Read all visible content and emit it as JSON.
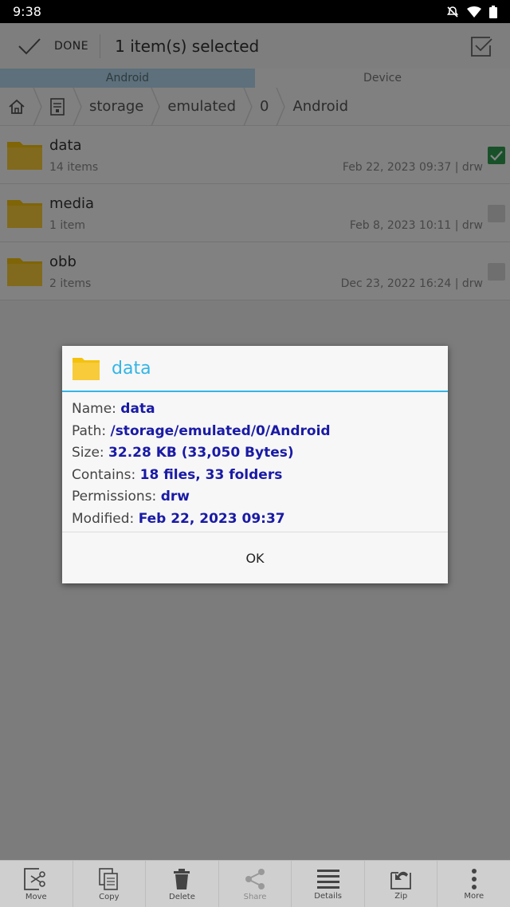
{
  "status_bar": {
    "time": "9:38"
  },
  "action_bar": {
    "done_label": "DONE",
    "title": "1 item(s) selected"
  },
  "tabs": [
    {
      "label": "Android"
    },
    {
      "label": "Device"
    }
  ],
  "breadcrumb": [
    "storage",
    "emulated",
    "0",
    "Android"
  ],
  "files": [
    {
      "name": "data",
      "count": "14 items",
      "modified": "Feb 22, 2023 09:37 | drw",
      "checked": true
    },
    {
      "name": "media",
      "count": "1 item",
      "modified": "Feb 8, 2023 10:11 | drw",
      "checked": false
    },
    {
      "name": "obb",
      "count": "2 items",
      "modified": "Dec 23, 2022 16:24 | drw",
      "checked": false
    }
  ],
  "dialog": {
    "title": "data",
    "rows": [
      {
        "label": "Name:",
        "value": "data"
      },
      {
        "label": "Path:",
        "value": "/storage/emulated/0/Android"
      },
      {
        "label": "Size:",
        "value": "32.28 KB (33,050 Bytes)"
      },
      {
        "label": "Contains:",
        "value": "18 files, 33 folders"
      },
      {
        "label": "Permissions:",
        "value": "drw"
      },
      {
        "label": "Modified:",
        "value": "Feb 22, 2023 09:37"
      }
    ],
    "ok_label": "OK"
  },
  "bottom_bar": [
    {
      "label": "Move",
      "icon": "move-icon"
    },
    {
      "label": "Copy",
      "icon": "copy-icon"
    },
    {
      "label": "Delete",
      "icon": "delete-icon"
    },
    {
      "label": "Share",
      "icon": "share-icon"
    },
    {
      "label": "Details",
      "icon": "details-icon"
    },
    {
      "label": "Zip",
      "icon": "zip-icon"
    },
    {
      "label": "More",
      "icon": "more-icon"
    }
  ],
  "colors": {
    "accent": "#33b5e5",
    "value_text": "#1a1aa6",
    "check_green": "#2e9c4f",
    "folder": "#f4c20d"
  }
}
